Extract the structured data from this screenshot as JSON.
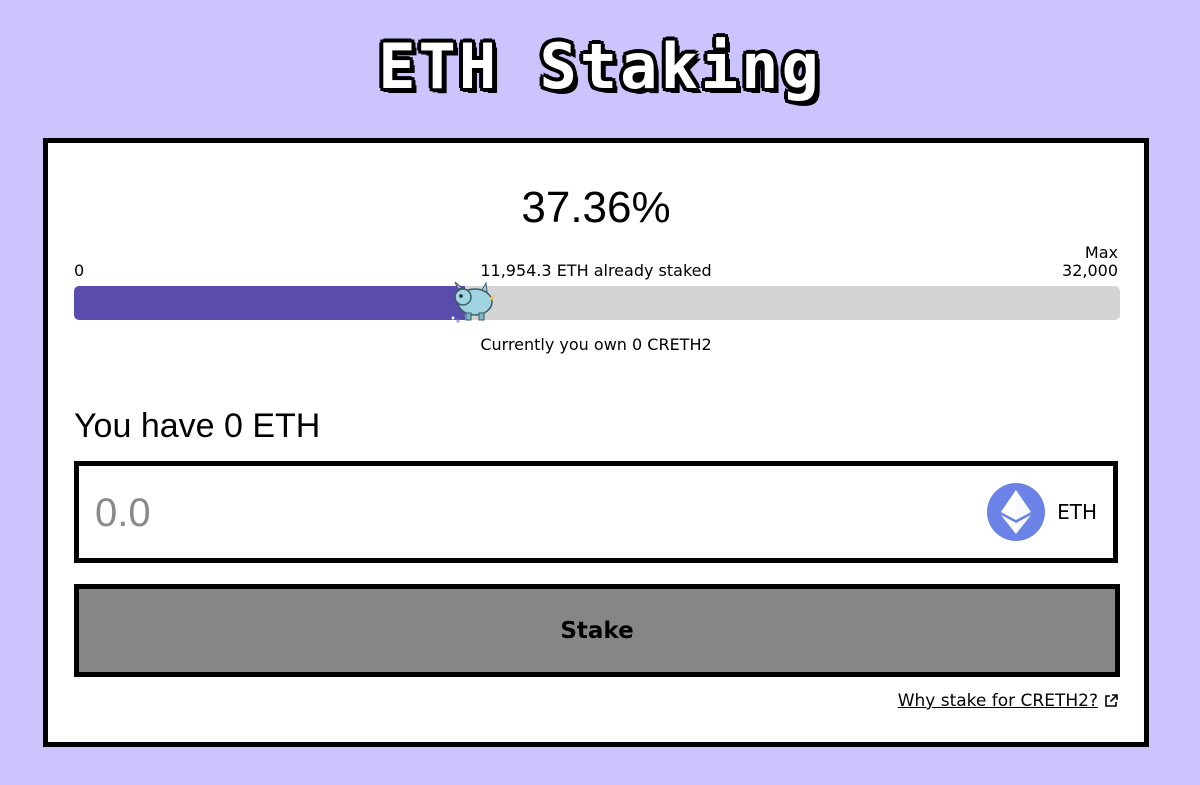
{
  "header": {
    "title": "ETH Staking"
  },
  "progress": {
    "percent_label": "37.36%",
    "fraction": 0.3736,
    "min_label": "0",
    "staked_label": "11,954.3 ETH already staked",
    "max_title": "Max",
    "max_value": "32,000",
    "owned_label": "Currently you own 0 CRETH2",
    "fill_color": "#5a4cad",
    "track_color": "#d4d4d4"
  },
  "wallet": {
    "balance_label": "You have 0 ETH"
  },
  "amount_input": {
    "placeholder": "0.0",
    "token_label": "ETH",
    "token_icon": "ethereum-icon"
  },
  "actions": {
    "stake_label": "Stake",
    "why_link_label": "Why stake for CRETH2?"
  },
  "colors": {
    "background": "#cbc4fe",
    "button": "#868686",
    "eth_icon": "#6b83e6"
  }
}
